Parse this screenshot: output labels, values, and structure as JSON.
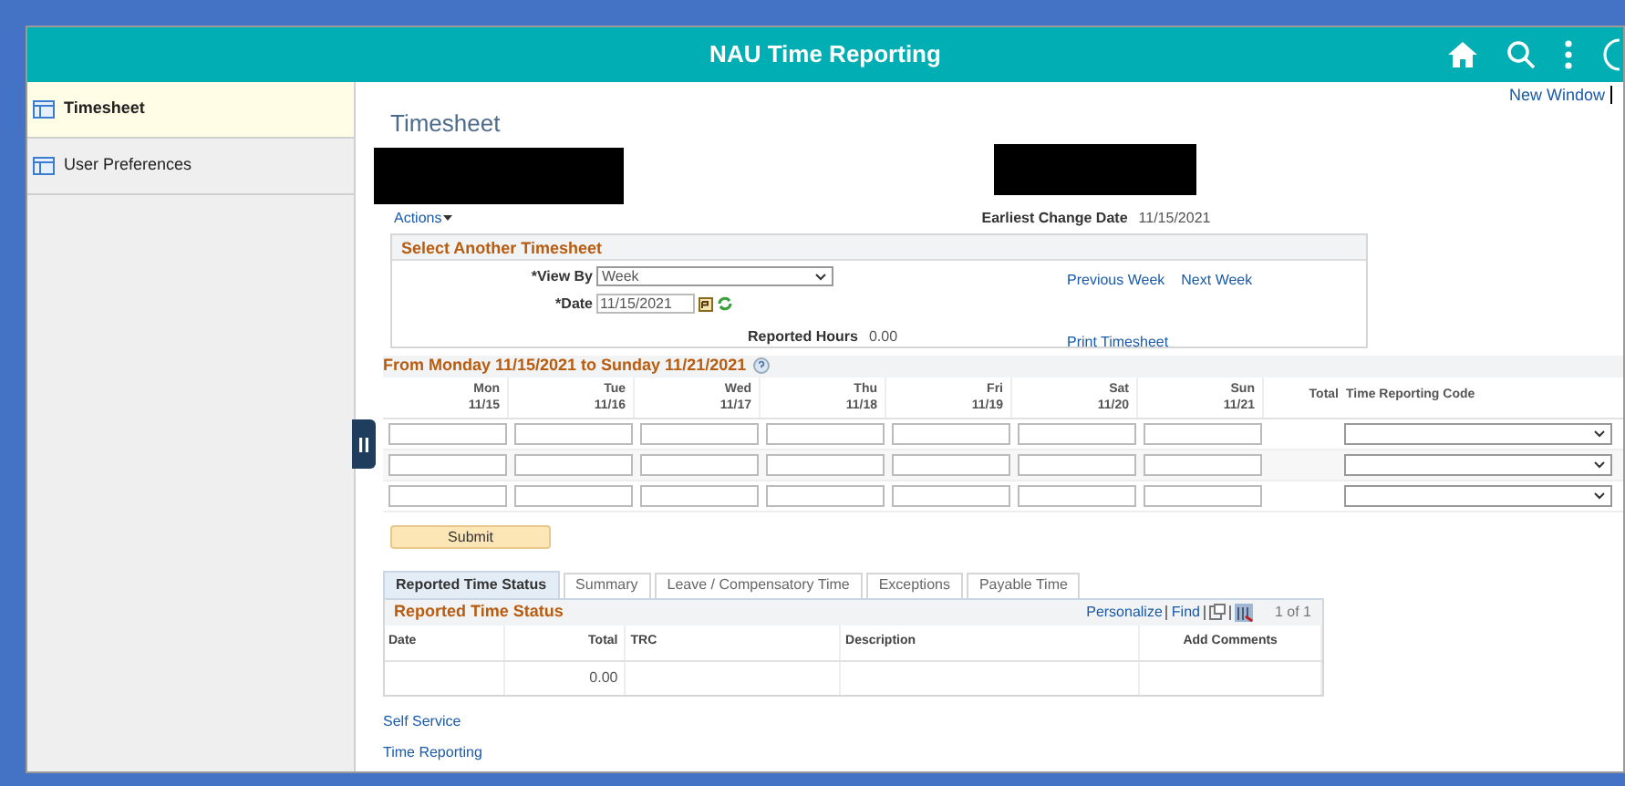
{
  "header": {
    "title": "NAU Time Reporting"
  },
  "sidebar": {
    "items": [
      {
        "label": "Timesheet",
        "selected": true
      },
      {
        "label": "User Preferences",
        "selected": false
      }
    ]
  },
  "main": {
    "new_window": "New Window",
    "title": "Timesheet",
    "actions": "Actions",
    "earliest_change": {
      "label": "Earliest Change Date",
      "value": "11/15/2021"
    }
  },
  "select_timesheet": {
    "title": "Select Another Timesheet",
    "view_by": {
      "label": "*View By",
      "value": "Week"
    },
    "date": {
      "label": "*Date",
      "value": "11/15/2021"
    },
    "reported_hours": {
      "label": "Reported Hours",
      "value": "0.00"
    },
    "links": [
      "Previous Week",
      "Next Week"
    ],
    "print": "Print Timesheet"
  },
  "time_grid": {
    "heading": "From Monday 11/15/2021 to Sunday 11/21/2021",
    "days": [
      {
        "day": "Mon",
        "date": "11/15"
      },
      {
        "day": "Tue",
        "date": "11/16"
      },
      {
        "day": "Wed",
        "date": "11/17"
      },
      {
        "day": "Thu",
        "date": "11/18"
      },
      {
        "day": "Fri",
        "date": "11/19"
      },
      {
        "day": "Sat",
        "date": "11/20"
      },
      {
        "day": "Sun",
        "date": "11/21"
      }
    ],
    "total_label": "Total",
    "trc_label": "Time Reporting Code",
    "rows": [
      {
        "kind": "entry"
      },
      {
        "kind": "entry"
      },
      {
        "kind": "entry"
      }
    ]
  },
  "submit": "Submit",
  "tabs": [
    {
      "label": "Reported Time Status",
      "selected": true
    },
    {
      "label": "Summary",
      "selected": false
    },
    {
      "label": "Leave / Compensatory Time",
      "selected": false
    },
    {
      "label": "Exceptions",
      "selected": false
    },
    {
      "label": "Payable Time",
      "selected": false
    }
  ],
  "status_grid": {
    "title": "Reported Time Status",
    "personalize": "Personalize",
    "find": "Find",
    "page": "1 of 1",
    "columns": [
      "Date",
      "Total",
      "TRC",
      "Description",
      "Add Comments"
    ],
    "rows": [
      {
        "total": "0.00"
      }
    ]
  },
  "footer_links": [
    "Self Service",
    "Time Reporting"
  ]
}
